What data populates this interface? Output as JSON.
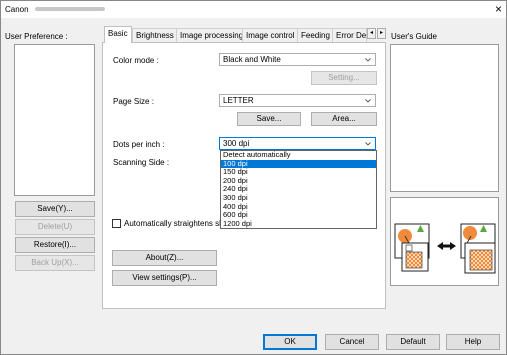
{
  "window": {
    "title": "Canon",
    "close_glyph": "×"
  },
  "left_panel": {
    "label": "User Preference :",
    "buttons": {
      "save": "Save(Y)...",
      "delete": "Delete(U)",
      "restore": "Restore(I)...",
      "backup": "Back Up(X)..."
    }
  },
  "tabs": [
    {
      "label": "Basic"
    },
    {
      "label": "Brightness"
    },
    {
      "label": "Image processing"
    },
    {
      "label": "Image control"
    },
    {
      "label": "Feeding"
    },
    {
      "label": "Error De"
    }
  ],
  "tab_scroll": {
    "left": "◂",
    "right": "▸"
  },
  "basic": {
    "color_mode": {
      "label": "Color mode :",
      "value": "Black and White",
      "setting_button": "Setting..."
    },
    "page_size": {
      "label": "Page Size :",
      "value": "LETTER",
      "save_button": "Save...",
      "area_button": "Area..."
    },
    "dpi": {
      "label": "Dots per inch :",
      "value": "300 dpi",
      "options": [
        "Detect automatically",
        "100 dpi",
        "150 dpi",
        "200 dpi",
        "240 dpi",
        "300 dpi",
        "400 dpi",
        "600 dpi",
        "1200 dpi"
      ],
      "highlighted": "100 dpi"
    },
    "scanning_side": {
      "label": "Scanning Side :"
    },
    "straighten": {
      "label": "Automatically straightens ske",
      "checked": false
    },
    "about_button": "About(Z)...",
    "view_settings_button": "View settings(P)..."
  },
  "right_panel": {
    "label": "User's Guide"
  },
  "bottom_buttons": {
    "ok": "OK",
    "cancel": "Cancel",
    "default": "Default",
    "help": "Help"
  },
  "colors": {
    "accent": "#0078d7",
    "illus_orange": "#f08a3c",
    "illus_green": "#5aa83c"
  }
}
